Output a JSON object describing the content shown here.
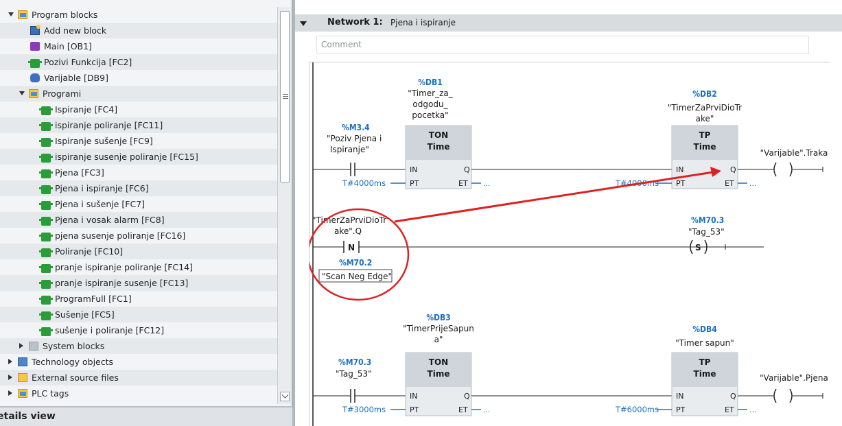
{
  "tree": {
    "items": [
      {
        "label": "Program blocks",
        "icon": "program-blocks-folder-icon",
        "level": 0,
        "expanded": true
      },
      {
        "label": "Add new block",
        "icon": "add-block-icon",
        "level": 1
      },
      {
        "label": "Main [OB1]",
        "icon": "ob-block-icon",
        "level": 1
      },
      {
        "label": "Pozivi Funkcija [FC2]",
        "icon": "fc-block-icon",
        "level": 1
      },
      {
        "label": "Varijable [DB9]",
        "icon": "db-block-icon",
        "level": 1
      },
      {
        "label": "Programi",
        "icon": "group-folder-icon",
        "level": 1,
        "expanded": true
      },
      {
        "label": "Ispiranje [FC4]",
        "icon": "fc-block-icon",
        "level": 2
      },
      {
        "label": "ispiranje poliranje [FC11]",
        "icon": "fc-block-icon",
        "level": 2
      },
      {
        "label": "Ispiranje sušenje [FC9]",
        "icon": "fc-block-icon",
        "level": 2
      },
      {
        "label": "ispiranje susenje poliranje [FC15]",
        "icon": "fc-block-icon",
        "level": 2
      },
      {
        "label": "Pjena [FC3]",
        "icon": "fc-block-icon",
        "level": 2
      },
      {
        "label": "Pjena i ispiranje [FC6]",
        "icon": "fc-block-icon",
        "level": 2
      },
      {
        "label": "Pjena i sušenje [FC7]",
        "icon": "fc-block-icon",
        "level": 2
      },
      {
        "label": "Pjena i vosak alarm [FC8]",
        "icon": "fc-block-icon",
        "level": 2
      },
      {
        "label": "pjena susenje poliranje [FC16]",
        "icon": "fc-block-icon",
        "level": 2
      },
      {
        "label": "Poliranje [FC10]",
        "icon": "fc-block-icon",
        "level": 2
      },
      {
        "label": "pranje ispiranje poliranje [FC14]",
        "icon": "fc-block-icon",
        "level": 2
      },
      {
        "label": "pranje ispiranje susenje [FC13]",
        "icon": "fc-block-icon",
        "level": 2
      },
      {
        "label": "ProgramFull [FC1]",
        "icon": "fc-block-icon",
        "level": 2
      },
      {
        "label": "Sušenje [FC5]",
        "icon": "fc-block-icon",
        "level": 2
      },
      {
        "label": "sušenje i poliranje [FC12]",
        "icon": "fc-block-icon",
        "level": 2
      },
      {
        "label": "System blocks",
        "icon": "system-blocks-icon",
        "level": 1,
        "expanded": false
      },
      {
        "label": "Technology objects",
        "icon": "technology-objects-icon",
        "level": 0,
        "expanded": false
      },
      {
        "label": "External source files",
        "icon": "external-files-icon",
        "level": 0,
        "expanded": false
      },
      {
        "label": "PLC tags",
        "icon": "plc-tags-icon",
        "level": 0,
        "expanded": false
      }
    ]
  },
  "details_view": {
    "label": "etails view"
  },
  "network": {
    "title": "Network 1:",
    "name": "Pjena i ispiranje",
    "comment_placeholder": "Comment",
    "rung1": {
      "contact_addr": "%M3.4",
      "contact_tag_1": "\"Poziv Pjena i",
      "contact_tag_2": "Ispiranje\"",
      "timer1_addr": "%DB1",
      "timer1_name_1": "\"Timer_za_",
      "timer1_name_2": "odgodu_",
      "timer1_name_3": "pocetka\"",
      "timer1_type": "TON",
      "timer1_sub": "Time",
      "timer1_pt": "T#4000ms",
      "timer2_addr": "%DB2",
      "timer2_name_1": "\"TimerZaPrviDioTr",
      "timer2_name_2": "ake\"",
      "timer2_type": "TP",
      "timer2_sub": "Time",
      "timer2_pt": "T#4000ms",
      "coil_tag": "\"Varijable\".Traka"
    },
    "rung2": {
      "contact_tag_1": "\"TimerZaPrviDioTr",
      "contact_tag_2": "ake\".Q",
      "neg_label": "N",
      "edge_addr": "%M70.2",
      "edge_tag": "\"Scan Neg Edge\"",
      "coil_addr": "%M70.3",
      "coil_tag": "\"Tag_53\"",
      "coil_label": "S"
    },
    "rung3": {
      "contact_addr": "%M70.3",
      "contact_tag": "\"Tag_53\"",
      "timer1_addr": "%DB3",
      "timer1_name_1": "\"TimerPrijeSapun",
      "timer1_name_2": "a\"",
      "timer1_type": "TON",
      "timer1_sub": "Time",
      "timer1_pt": "T#3000ms",
      "timer2_addr": "%DB4",
      "timer2_name_1": "\"Timer sapun\"",
      "timer2_type": "TP",
      "timer2_sub": "Time",
      "timer2_pt": "T#6000ms",
      "coil_tag": "\"Varijable\".Pjena"
    },
    "pins": {
      "in": "IN",
      "pt": "PT",
      "q": "Q",
      "et": "ET",
      "et_value": "..."
    }
  },
  "colors": {
    "annotation_red": "#e02020",
    "address_blue": "#1a6fc4",
    "fc_green": "#2a9d3a",
    "ob_purple": "#8a3ac0"
  }
}
